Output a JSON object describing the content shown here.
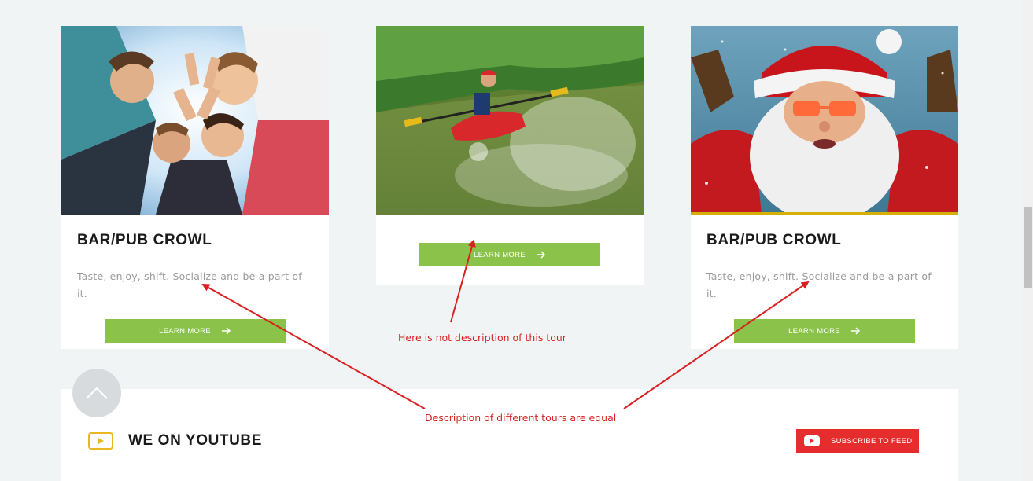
{
  "cards": [
    {
      "title": "BAR/PUB CROWL",
      "description": "Taste, enjoy, shift. Socialize and be a part of it.",
      "button_label": "LEARN MORE",
      "image": "friends-selfie-photo"
    },
    {
      "title": "",
      "description": "",
      "button_label": "LEARN MORE",
      "image": "kayak-river-photo"
    },
    {
      "title": "BAR/PUB CROWL",
      "description": "Taste, enjoy, shift. Socialize and be a part of it.",
      "button_label": "LEARN MORE",
      "image": "santa-sunglasses-photo"
    }
  ],
  "youtube": {
    "title": "WE ON YOUTUBE",
    "subscribe_label": "SUBSCRIBE TO FEED",
    "icon": "play-icon"
  },
  "annotations": {
    "missing_description": "Here is not description of this tour",
    "equal_descriptions": "Description of different tours are equal"
  },
  "colors": {
    "page_background": "#f1f4f5",
    "button_green": "#8bc34a",
    "subscribe_red": "#e52d2d",
    "youtube_icon_yellow": "#e9b820",
    "annotation_red": "#d92020"
  }
}
